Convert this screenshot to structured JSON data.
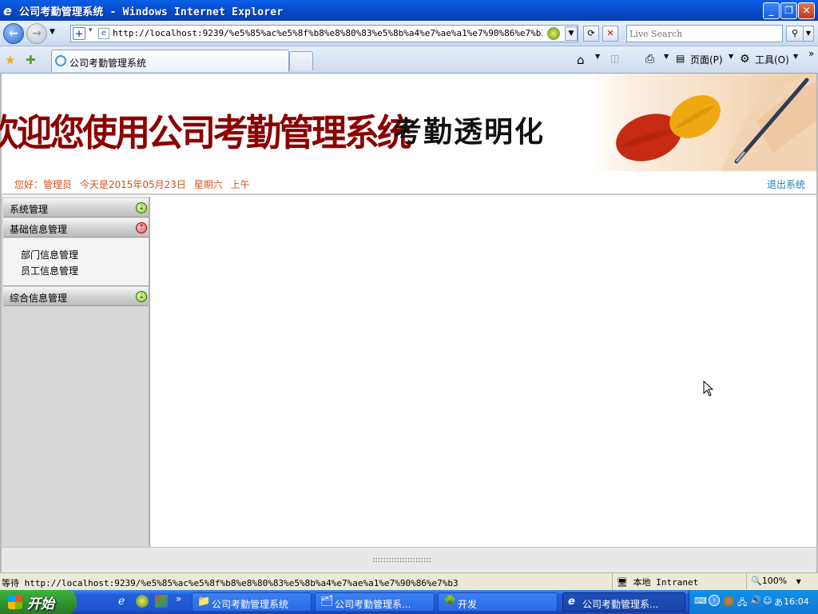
{
  "window": {
    "title": "公司考勤管理系统 - Windows Internet Explorer"
  },
  "addressbar": {
    "url": "http://localhost:9239/%e5%85%ac%e5%8f%b8%e8%80%83%e5%8b%a4%e7%ae%a1%e7%90%86%e7%b3%bb%e7%b",
    "search_placeholder": "Live Search"
  },
  "tabs": [
    {
      "label": "公司考勤管理系统"
    }
  ],
  "commandbar": {
    "page_label": "页面(P)",
    "tools_label": "工具(O)"
  },
  "banner": {
    "main_text": "欢迎您使用公司考勤管理系统",
    "slogan": "考勤透明化"
  },
  "userbar": {
    "greeting": "您好：管理员",
    "date": "今天是2015年05月23日",
    "weekday": "星期六",
    "period": "上午",
    "logout": "退出系统"
  },
  "sidebar": {
    "groups": [
      {
        "label": "系统管理",
        "expanded": false
      },
      {
        "label": "基础信息管理",
        "expanded": true,
        "items": [
          "部门信息管理",
          "员工信息管理"
        ]
      },
      {
        "label": "综合信息管理",
        "expanded": false
      }
    ]
  },
  "splitter": {
    "handle": "::::::::::::::::::::::"
  },
  "statusbar": {
    "status": "等待 http://localhost:9239/%e5%85%ac%e5%8f%b8%e8%80%83%e5%8b%a4%e7%ae%a1%e7%90%86%e7%b3",
    "zone": "本地 Intranet",
    "zoom": "100%"
  },
  "taskbar": {
    "start_label": "开始",
    "buttons": [
      {
        "label": "公司考勤管理系统",
        "icon": "folder-icon"
      },
      {
        "label": "公司考勤管理系...",
        "icon": "app-icon"
      },
      {
        "label": "开发",
        "icon": "tree-icon"
      },
      {
        "label": "公司考勤管理系...",
        "icon": "ie-icon"
      }
    ],
    "clock": "16:04"
  }
}
